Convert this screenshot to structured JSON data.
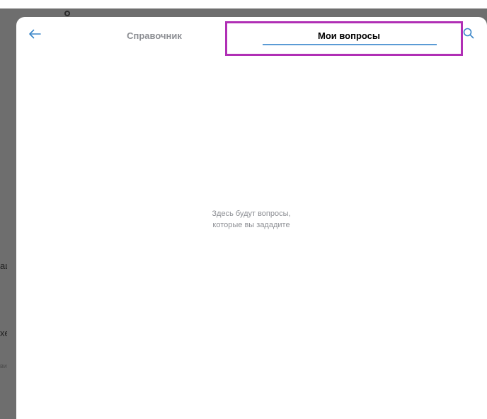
{
  "header": {
    "back_icon": "arrow-left-icon",
    "tabs": [
      {
        "label": "Справочник",
        "active": false
      },
      {
        "label": "Мои вопросы",
        "active": true
      }
    ],
    "search_icon": "search-icon"
  },
  "empty_state": {
    "line1": "Здесь будут вопросы,",
    "line2": "которые вы зададите"
  },
  "background_fragments": [
    "ац",
    "хе",
    "ви"
  ],
  "colors": {
    "accent": "#5b9bd5",
    "highlight": "#b02fb5",
    "muted_text": "#8d8f94",
    "backdrop": "#6e6e6e"
  }
}
